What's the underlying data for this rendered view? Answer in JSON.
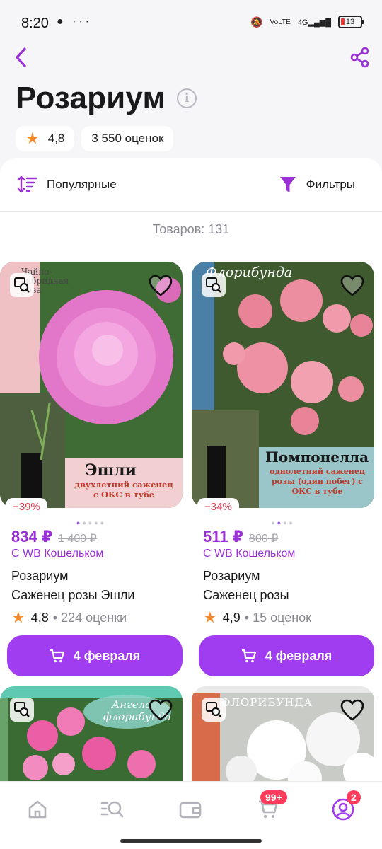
{
  "status": {
    "time": "8:20",
    "battery": "13"
  },
  "header": {
    "title": "Розариум"
  },
  "chips": {
    "rating": "4,8",
    "reviews": "3 550 оценок"
  },
  "sort": {
    "label": "Популярные"
  },
  "filter": {
    "label": "Фильтры"
  },
  "count": "Товаров: 131",
  "products": [
    {
      "discount": "−39%",
      "price": "834 ₽",
      "old_price": "1 400 ₽",
      "wallet_note": "С WB Кошельком",
      "brand": "Розариум",
      "name": "Саженец розы Эшли",
      "rating": "4,8",
      "reviews": "• 224 оценки",
      "delivery": "4 февраля",
      "img_caption_top": "Чайно-гибридная роза",
      "img_caption_title": "Эшли",
      "img_caption_sub": "двухлетний саженец с ОКС в тубе"
    },
    {
      "discount": "−34%",
      "price": "511 ₽",
      "old_price": "800 ₽",
      "wallet_note": "С WB Кошельком",
      "brand": "Розариум",
      "name": "Саженец розы",
      "rating": "4,9",
      "reviews": "• 15 оценок",
      "delivery": "4 февраля",
      "img_caption_top": "Флорибунда",
      "img_caption_title": "Помпонелла",
      "img_caption_sub": "однолетний саженец розы (один побег) с ОКС в тубе"
    },
    {
      "img_caption_top": "Ангела флорибунда"
    },
    {
      "img_caption_top": "ФЛОРИБУНДА"
    }
  ],
  "bottom_nav": {
    "cart_badge": "99+",
    "profile_badge": "2"
  },
  "colors": {
    "accent": "#a13df0",
    "price": "#9b2fd8",
    "discount": "#e53950",
    "star": "#f08a2b"
  }
}
